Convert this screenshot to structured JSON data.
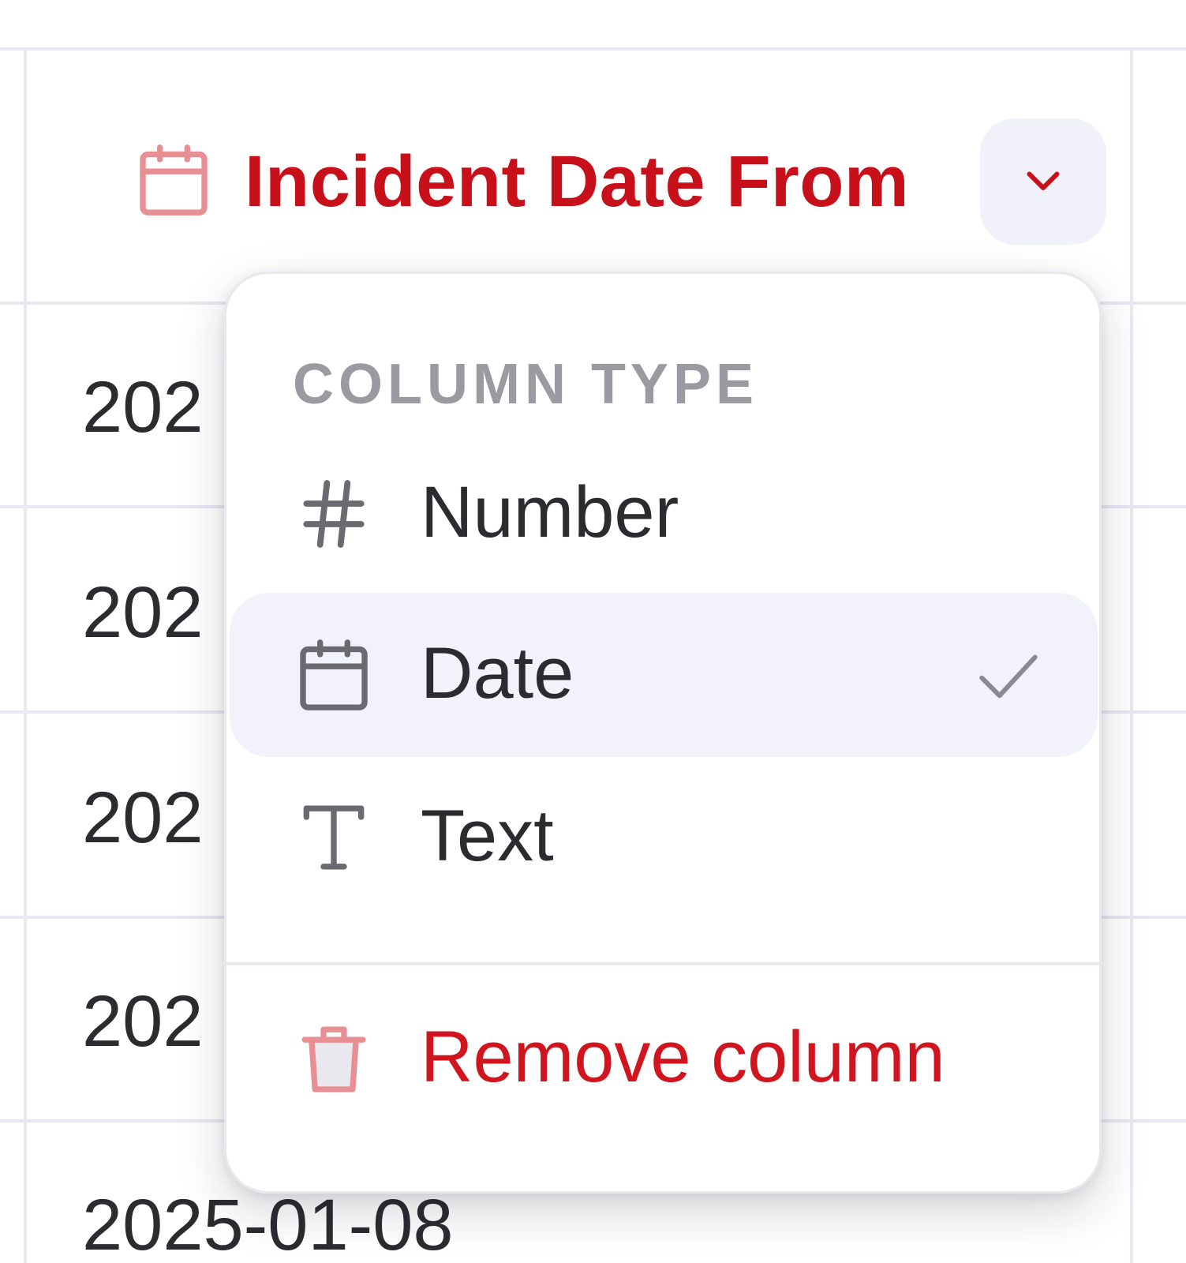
{
  "header": {
    "title": "Incident Date From",
    "icon": "calendar-icon",
    "dropdown_icon": "chevron-down-icon",
    "accent_color": "#c8101a"
  },
  "rows": [
    {
      "value": "202"
    },
    {
      "value": "202"
    },
    {
      "value": "202"
    },
    {
      "value": "202"
    },
    {
      "value": "2025-01-08"
    }
  ],
  "menu": {
    "section_title": "COLUMN TYPE",
    "items": [
      {
        "label": "Number",
        "icon": "hash-icon",
        "selected": false
      },
      {
        "label": "Date",
        "icon": "calendar-icon",
        "selected": true,
        "check_icon": "check-icon"
      },
      {
        "label": "Text",
        "icon": "text-type-icon",
        "selected": false
      }
    ],
    "remove": {
      "label": "Remove column",
      "icon": "trash-icon",
      "color": "#d1151f"
    }
  }
}
